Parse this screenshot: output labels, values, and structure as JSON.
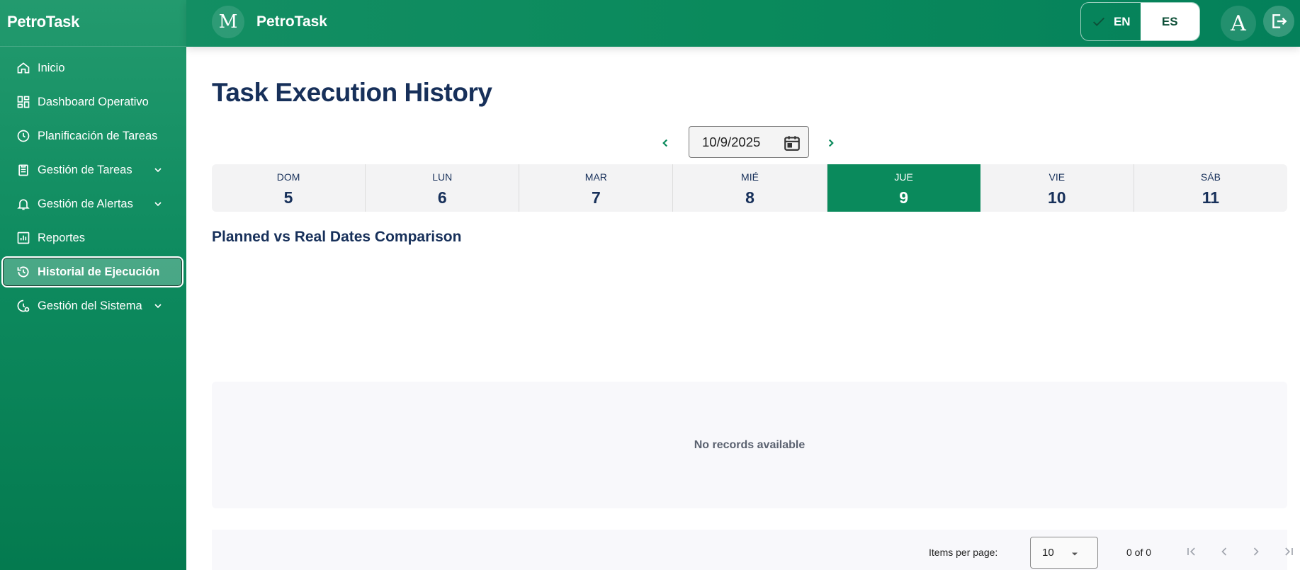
{
  "sidebar": {
    "brand": "PetroTask",
    "items": [
      {
        "label": "Inicio",
        "icon": "home-icon"
      },
      {
        "label": "Dashboard Operativo",
        "icon": "dashboard-icon"
      },
      {
        "label": "Planificación de Tareas",
        "icon": "clock-icon"
      },
      {
        "label": "Gestión de Tareas",
        "icon": "clipboard-icon",
        "expandable": true
      },
      {
        "label": "Gestión de Alertas",
        "icon": "bell-icon",
        "expandable": true
      },
      {
        "label": "Reportes",
        "icon": "bar-chart-icon"
      },
      {
        "label": "Historial de Ejecución",
        "icon": "history-icon",
        "active": true
      },
      {
        "label": "Gestión del Sistema",
        "icon": "system-settings-icon",
        "expandable": true
      }
    ]
  },
  "header": {
    "logo_letter": "M",
    "title": "PetroTask",
    "lang": {
      "en": "EN",
      "es": "ES",
      "selected": "EN"
    },
    "avatar_letter": "A"
  },
  "main": {
    "title": "Task Execution History",
    "date_value": "10/9/2025",
    "week": [
      {
        "name": "DOM",
        "num": "5"
      },
      {
        "name": "LUN",
        "num": "6"
      },
      {
        "name": "MAR",
        "num": "7"
      },
      {
        "name": "MIÉ",
        "num": "8"
      },
      {
        "name": "JUE",
        "num": "9",
        "active": true
      },
      {
        "name": "VIE",
        "num": "10"
      },
      {
        "name": "SÁB",
        "num": "11"
      }
    ],
    "section_title": "Planned vs Real Dates Comparison",
    "empty_text": "No records available"
  },
  "paginator": {
    "items_label": "Items per page:",
    "page_size": "10",
    "range": "0 of 0"
  },
  "colors": {
    "primary": "#0a8a5c",
    "title": "#17305a"
  }
}
